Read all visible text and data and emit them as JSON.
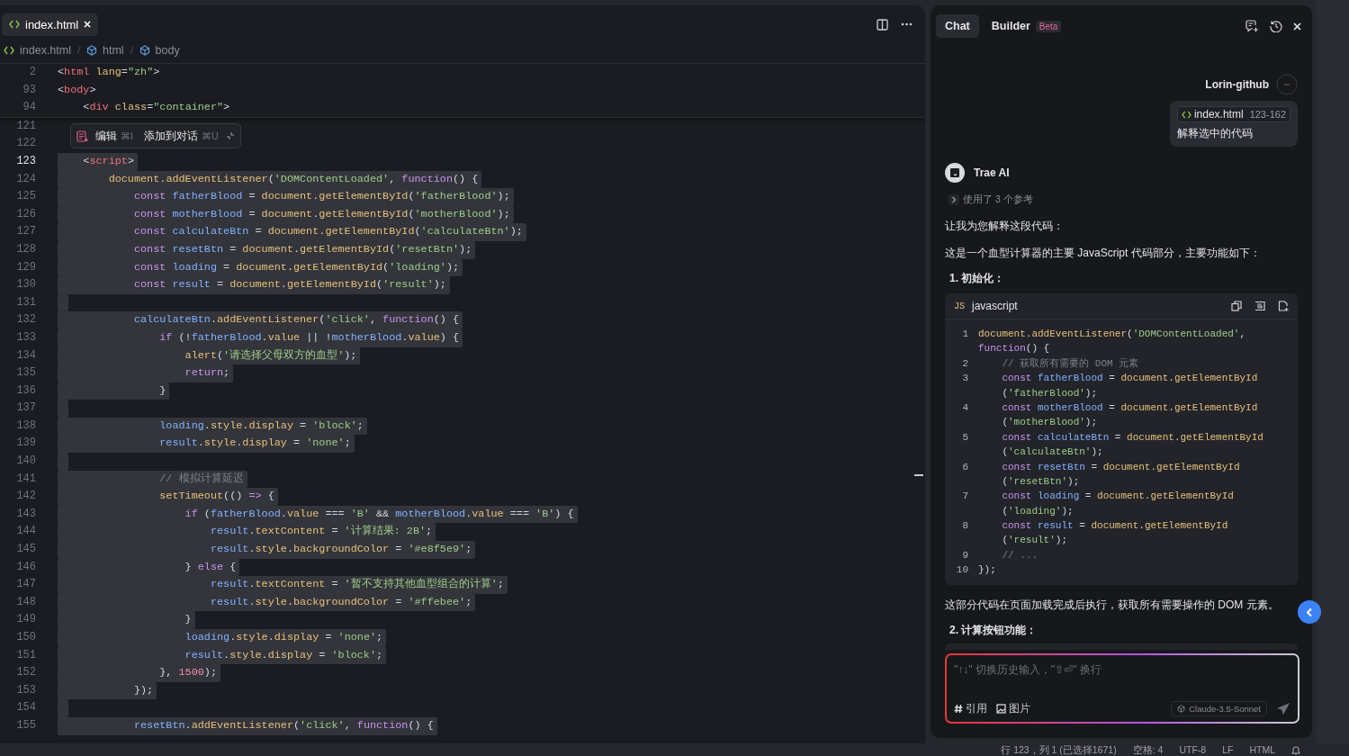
{
  "editor": {
    "tabs": [
      {
        "label": "index.html",
        "selected": true
      }
    ],
    "breadcrumb": [
      "index.html",
      "html",
      "body"
    ],
    "sticky_lines": [
      {
        "number": "2",
        "tokens": [
          {
            "kind": "p",
            "text": "<"
          },
          {
            "kind": "tag",
            "text": "html"
          },
          {
            "kind": "attr",
            "text": " lang"
          },
          {
            "kind": "p",
            "text": "="
          },
          {
            "kind": "str",
            "text": "\"zh\""
          },
          {
            "kind": "p",
            "text": ">"
          }
        ]
      },
      {
        "number": "93",
        "tokens": [
          {
            "kind": "p",
            "text": "<"
          },
          {
            "kind": "tag",
            "text": "body"
          },
          {
            "kind": "p",
            "text": ">"
          }
        ]
      },
      {
        "number": "94",
        "tokens": [
          {
            "kind": "p",
            "text": "    <"
          },
          {
            "kind": "tag",
            "text": "div"
          },
          {
            "kind": "attr",
            "text": " class"
          },
          {
            "kind": "p",
            "text": "="
          },
          {
            "kind": "str",
            "text": "\"container\""
          },
          {
            "kind": "p",
            "text": ">"
          }
        ]
      }
    ],
    "popup": {
      "items": [
        {
          "label": "编辑",
          "shortcut": "⌘I"
        },
        {
          "label": "添加到对话",
          "shortcut": "⌘U"
        }
      ]
    },
    "lines": [
      {
        "number": "121",
        "selected": false,
        "current": false
      },
      {
        "number": "122",
        "selected": false,
        "current": false
      },
      {
        "number": "123",
        "selected": true,
        "current": true,
        "tokens": [
          {
            "kind": "p",
            "text": "    <"
          },
          {
            "kind": "tag",
            "text": "script"
          },
          {
            "kind": "p",
            "text": ">"
          }
        ]
      },
      {
        "number": "124",
        "selected": true,
        "current": false,
        "tokens": [
          {
            "kind": "fn",
            "text": "        document"
          },
          {
            "kind": "p",
            "text": "."
          },
          {
            "kind": "fn",
            "text": "addEventListener"
          },
          {
            "kind": "p",
            "text": "("
          },
          {
            "kind": "str",
            "text": "'DOMContentLoaded'"
          },
          {
            "kind": "p",
            "text": ", "
          },
          {
            "kind": "kw",
            "text": "function"
          },
          {
            "kind": "p",
            "text": "() {"
          }
        ]
      },
      {
        "number": "125",
        "selected": true,
        "current": false,
        "tokens": [
          {
            "kind": "kw",
            "text": "            const"
          },
          {
            "kind": "var",
            "text": " fatherBlood"
          },
          {
            "kind": "p",
            "text": " = "
          },
          {
            "kind": "fn",
            "text": "document"
          },
          {
            "kind": "p",
            "text": "."
          },
          {
            "kind": "fn",
            "text": "getElementById"
          },
          {
            "kind": "p",
            "text": "("
          },
          {
            "kind": "str",
            "text": "'fatherBlood'"
          },
          {
            "kind": "p",
            "text": ");"
          }
        ]
      },
      {
        "number": "126",
        "selected": true,
        "current": false,
        "tokens": [
          {
            "kind": "kw",
            "text": "            const"
          },
          {
            "kind": "var",
            "text": " motherBlood"
          },
          {
            "kind": "p",
            "text": " = "
          },
          {
            "kind": "fn",
            "text": "document"
          },
          {
            "kind": "p",
            "text": "."
          },
          {
            "kind": "fn",
            "text": "getElementById"
          },
          {
            "kind": "p",
            "text": "("
          },
          {
            "kind": "str",
            "text": "'motherBlood'"
          },
          {
            "kind": "p",
            "text": ");"
          }
        ]
      },
      {
        "number": "127",
        "selected": true,
        "current": false,
        "tokens": [
          {
            "kind": "kw",
            "text": "            const"
          },
          {
            "kind": "var",
            "text": " calculateBtn"
          },
          {
            "kind": "p",
            "text": " = "
          },
          {
            "kind": "fn",
            "text": "document"
          },
          {
            "kind": "p",
            "text": "."
          },
          {
            "kind": "fn",
            "text": "getElementById"
          },
          {
            "kind": "p",
            "text": "("
          },
          {
            "kind": "str",
            "text": "'calculateBtn'"
          },
          {
            "kind": "p",
            "text": ");"
          }
        ]
      },
      {
        "number": "128",
        "selected": true,
        "current": false,
        "tokens": [
          {
            "kind": "kw",
            "text": "            const"
          },
          {
            "kind": "var",
            "text": " resetBtn"
          },
          {
            "kind": "p",
            "text": " = "
          },
          {
            "kind": "fn",
            "text": "document"
          },
          {
            "kind": "p",
            "text": "."
          },
          {
            "kind": "fn",
            "text": "getElementById"
          },
          {
            "kind": "p",
            "text": "("
          },
          {
            "kind": "str",
            "text": "'resetBtn'"
          },
          {
            "kind": "p",
            "text": ");"
          }
        ]
      },
      {
        "number": "129",
        "selected": true,
        "current": false,
        "tokens": [
          {
            "kind": "kw",
            "text": "            const"
          },
          {
            "kind": "var",
            "text": " loading"
          },
          {
            "kind": "p",
            "text": " = "
          },
          {
            "kind": "fn",
            "text": "document"
          },
          {
            "kind": "p",
            "text": "."
          },
          {
            "kind": "fn",
            "text": "getElementById"
          },
          {
            "kind": "p",
            "text": "("
          },
          {
            "kind": "str",
            "text": "'loading'"
          },
          {
            "kind": "p",
            "text": ");"
          }
        ]
      },
      {
        "number": "130",
        "selected": true,
        "current": false,
        "tokens": [
          {
            "kind": "kw",
            "text": "            const"
          },
          {
            "kind": "var",
            "text": " result"
          },
          {
            "kind": "p",
            "text": " = "
          },
          {
            "kind": "fn",
            "text": "document"
          },
          {
            "kind": "p",
            "text": "."
          },
          {
            "kind": "fn",
            "text": "getElementById"
          },
          {
            "kind": "p",
            "text": "("
          },
          {
            "kind": "str",
            "text": "'result'"
          },
          {
            "kind": "p",
            "text": ");"
          }
        ]
      },
      {
        "number": "131",
        "selected": true,
        "current": false
      },
      {
        "number": "132",
        "selected": true,
        "current": false,
        "tokens": [
          {
            "kind": "var",
            "text": "            calculateBtn"
          },
          {
            "kind": "p",
            "text": "."
          },
          {
            "kind": "fn",
            "text": "addEventListener"
          },
          {
            "kind": "p",
            "text": "("
          },
          {
            "kind": "str",
            "text": "'click'"
          },
          {
            "kind": "p",
            "text": ", "
          },
          {
            "kind": "kw",
            "text": "function"
          },
          {
            "kind": "p",
            "text": "() {"
          }
        ]
      },
      {
        "number": "133",
        "selected": true,
        "current": false,
        "tokens": [
          {
            "kind": "kw",
            "text": "                if"
          },
          {
            "kind": "p",
            "text": " (!"
          },
          {
            "kind": "var",
            "text": "fatherBlood"
          },
          {
            "kind": "p",
            "text": "."
          },
          {
            "kind": "fn",
            "text": "value"
          },
          {
            "kind": "p",
            "text": " || !"
          },
          {
            "kind": "var",
            "text": "motherBlood"
          },
          {
            "kind": "p",
            "text": "."
          },
          {
            "kind": "fn",
            "text": "value"
          },
          {
            "kind": "p",
            "text": ") {"
          }
        ]
      },
      {
        "number": "134",
        "selected": true,
        "current": false,
        "tokens": [
          {
            "kind": "fn",
            "text": "                    alert"
          },
          {
            "kind": "p",
            "text": "("
          },
          {
            "kind": "str",
            "text": "'请选择父母双方的血型'"
          },
          {
            "kind": "p",
            "text": ");"
          }
        ]
      },
      {
        "number": "135",
        "selected": true,
        "current": false,
        "tokens": [
          {
            "kind": "kw",
            "text": "                    return"
          },
          {
            "kind": "p",
            "text": ";"
          }
        ]
      },
      {
        "number": "136",
        "selected": true,
        "current": false,
        "tokens": [
          {
            "kind": "p",
            "text": "                }"
          }
        ]
      },
      {
        "number": "137",
        "selected": true,
        "current": false
      },
      {
        "number": "138",
        "selected": true,
        "current": false,
        "tokens": [
          {
            "kind": "var",
            "text": "                loading"
          },
          {
            "kind": "p",
            "text": "."
          },
          {
            "kind": "fn",
            "text": "style"
          },
          {
            "kind": "p",
            "text": "."
          },
          {
            "kind": "fn",
            "text": "display"
          },
          {
            "kind": "p",
            "text": " = "
          },
          {
            "kind": "str",
            "text": "'block'"
          },
          {
            "kind": "p",
            "text": ";"
          }
        ]
      },
      {
        "number": "139",
        "selected": true,
        "current": false,
        "tokens": [
          {
            "kind": "var",
            "text": "                result"
          },
          {
            "kind": "p",
            "text": "."
          },
          {
            "kind": "fn",
            "text": "style"
          },
          {
            "kind": "p",
            "text": "."
          },
          {
            "kind": "fn",
            "text": "display"
          },
          {
            "kind": "p",
            "text": " = "
          },
          {
            "kind": "str",
            "text": "'none'"
          },
          {
            "kind": "p",
            "text": ";"
          }
        ]
      },
      {
        "number": "140",
        "selected": true,
        "current": false
      },
      {
        "number": "141",
        "selected": true,
        "current": false,
        "tokens": [
          {
            "kind": "cm",
            "text": "                // 模拟计算延迟"
          }
        ]
      },
      {
        "number": "142",
        "selected": true,
        "current": false,
        "tokens": [
          {
            "kind": "fn",
            "text": "                setTimeout"
          },
          {
            "kind": "p",
            "text": "(() "
          },
          {
            "kind": "kw",
            "text": "=>"
          },
          {
            "kind": "p",
            "text": " {"
          }
        ]
      },
      {
        "number": "143",
        "selected": true,
        "current": false,
        "tokens": [
          {
            "kind": "kw",
            "text": "                    if"
          },
          {
            "kind": "p",
            "text": " ("
          },
          {
            "kind": "var",
            "text": "fatherBlood"
          },
          {
            "kind": "p",
            "text": "."
          },
          {
            "kind": "fn",
            "text": "value"
          },
          {
            "kind": "p",
            "text": " === "
          },
          {
            "kind": "str",
            "text": "'B'"
          },
          {
            "kind": "p",
            "text": " && "
          },
          {
            "kind": "var",
            "text": "motherBlood"
          },
          {
            "kind": "p",
            "text": "."
          },
          {
            "kind": "fn",
            "text": "value"
          },
          {
            "kind": "p",
            "text": " === "
          },
          {
            "kind": "str",
            "text": "'B'"
          },
          {
            "kind": "p",
            "text": ") {"
          }
        ]
      },
      {
        "number": "144",
        "selected": true,
        "current": false,
        "tokens": [
          {
            "kind": "var",
            "text": "                        result"
          },
          {
            "kind": "p",
            "text": "."
          },
          {
            "kind": "fn",
            "text": "textContent"
          },
          {
            "kind": "p",
            "text": " = "
          },
          {
            "kind": "str",
            "text": "'计算结果: 2B'"
          },
          {
            "kind": "p",
            "text": ";"
          }
        ]
      },
      {
        "number": "145",
        "selected": true,
        "current": false,
        "tokens": [
          {
            "kind": "var",
            "text": "                        result"
          },
          {
            "kind": "p",
            "text": "."
          },
          {
            "kind": "fn",
            "text": "style"
          },
          {
            "kind": "p",
            "text": "."
          },
          {
            "kind": "fn",
            "text": "backgroundColor"
          },
          {
            "kind": "p",
            "text": " = "
          },
          {
            "kind": "str",
            "text": "'#e8f5e9'"
          },
          {
            "kind": "p",
            "text": ";"
          }
        ]
      },
      {
        "number": "146",
        "selected": true,
        "current": false,
        "tokens": [
          {
            "kind": "p",
            "text": "                    } "
          },
          {
            "kind": "kw",
            "text": "else"
          },
          {
            "kind": "p",
            "text": " {"
          }
        ]
      },
      {
        "number": "147",
        "selected": true,
        "current": false,
        "tokens": [
          {
            "kind": "var",
            "text": "                        result"
          },
          {
            "kind": "p",
            "text": "."
          },
          {
            "kind": "fn",
            "text": "textContent"
          },
          {
            "kind": "p",
            "text": " = "
          },
          {
            "kind": "str",
            "text": "'暂不支持其他血型组合的计算'"
          },
          {
            "kind": "p",
            "text": ";"
          }
        ]
      },
      {
        "number": "148",
        "selected": true,
        "current": false,
        "tokens": [
          {
            "kind": "var",
            "text": "                        result"
          },
          {
            "kind": "p",
            "text": "."
          },
          {
            "kind": "fn",
            "text": "style"
          },
          {
            "kind": "p",
            "text": "."
          },
          {
            "kind": "fn",
            "text": "backgroundColor"
          },
          {
            "kind": "p",
            "text": " = "
          },
          {
            "kind": "str",
            "text": "'#ffebee'"
          },
          {
            "kind": "p",
            "text": ";"
          }
        ]
      },
      {
        "number": "149",
        "selected": true,
        "current": false,
        "tokens": [
          {
            "kind": "p",
            "text": "                    }"
          }
        ]
      },
      {
        "number": "150",
        "selected": true,
        "current": false,
        "tokens": [
          {
            "kind": "var",
            "text": "                    loading"
          },
          {
            "kind": "p",
            "text": "."
          },
          {
            "kind": "fn",
            "text": "style"
          },
          {
            "kind": "p",
            "text": "."
          },
          {
            "kind": "fn",
            "text": "display"
          },
          {
            "kind": "p",
            "text": " = "
          },
          {
            "kind": "str",
            "text": "'none'"
          },
          {
            "kind": "p",
            "text": ";"
          }
        ]
      },
      {
        "number": "151",
        "selected": true,
        "current": false,
        "tokens": [
          {
            "kind": "var",
            "text": "                    result"
          },
          {
            "kind": "p",
            "text": "."
          },
          {
            "kind": "fn",
            "text": "style"
          },
          {
            "kind": "p",
            "text": "."
          },
          {
            "kind": "fn",
            "text": "display"
          },
          {
            "kind": "p",
            "text": " = "
          },
          {
            "kind": "str",
            "text": "'block'"
          },
          {
            "kind": "p",
            "text": ";"
          }
        ]
      },
      {
        "number": "152",
        "selected": true,
        "current": false,
        "tokens": [
          {
            "kind": "p",
            "text": "                }, "
          },
          {
            "kind": "num",
            "text": "1500"
          },
          {
            "kind": "p",
            "text": ");"
          }
        ]
      },
      {
        "number": "153",
        "selected": true,
        "current": false,
        "tokens": [
          {
            "kind": "p",
            "text": "            });"
          }
        ]
      },
      {
        "number": "154",
        "selected": true,
        "current": false
      },
      {
        "number": "155",
        "selected": true,
        "current": false,
        "tokens": [
          {
            "kind": "var",
            "text": "            resetBtn"
          },
          {
            "kind": "p",
            "text": "."
          },
          {
            "kind": "fn",
            "text": "addEventListener"
          },
          {
            "kind": "p",
            "text": "("
          },
          {
            "kind": "str",
            "text": "'click'"
          },
          {
            "kind": "p",
            "text": ", "
          },
          {
            "kind": "kw",
            "text": "function"
          },
          {
            "kind": "p",
            "text": "() {"
          }
        ]
      }
    ]
  },
  "chat": {
    "tabs": [
      {
        "label": "Chat",
        "selected": true
      },
      {
        "label": "Builder",
        "selected": false,
        "badge": "Beta"
      }
    ],
    "user": {
      "name": "Lorin-github",
      "file": "index.html",
      "range": "123-162",
      "message": "解释选中的代码"
    },
    "assistant": {
      "name": "Trae AI",
      "references": {
        "label": "使用了 3 个参考",
        "expanded": false
      },
      "blocks": [
        {
          "kind": "text",
          "text": "让我为您解释这段代码："
        },
        {
          "kind": "text",
          "text": "这是一个血型计算器的主要 JavaScript 代码部分，主要功能如下："
        },
        {
          "kind": "heading",
          "text": "1. 初始化："
        },
        {
          "kind": "code",
          "badge": "JS",
          "language": "javascript",
          "lines": [
            {
              "number": "1",
              "rows": [
                {
                  "tokens": [
                    {
                      "kind": "fn",
                      "text": "document"
                    },
                    {
                      "kind": "p",
                      "text": "."
                    },
                    {
                      "kind": "fn",
                      "text": "addEventListener"
                    },
                    {
                      "kind": "p",
                      "text": "("
                    },
                    {
                      "kind": "str",
                      "text": "'DOMContentLoaded'"
                    },
                    {
                      "kind": "p",
                      "text": ","
                    }
                  ]
                },
                {
                  "tokens": [
                    {
                      "kind": "kw",
                      "text": "function"
                    },
                    {
                      "kind": "p",
                      "text": "() {"
                    }
                  ]
                }
              ]
            },
            {
              "number": "2",
              "rows": [
                {
                  "tokens": [
                    {
                      "kind": "cm",
                      "text": "    // 获取所有需要的 DOM 元素"
                    }
                  ]
                }
              ]
            },
            {
              "number": "3",
              "rows": [
                {
                  "tokens": [
                    {
                      "kind": "kw",
                      "text": "    const"
                    },
                    {
                      "kind": "var",
                      "text": " fatherBlood"
                    },
                    {
                      "kind": "p",
                      "text": " = "
                    },
                    {
                      "kind": "fn",
                      "text": "document"
                    },
                    {
                      "kind": "p",
                      "text": "."
                    },
                    {
                      "kind": "fn",
                      "text": "getElementById"
                    }
                  ]
                },
                {
                  "tokens": [
                    {
                      "kind": "p",
                      "text": "    ("
                    },
                    {
                      "kind": "str",
                      "text": "'fatherBlood'"
                    },
                    {
                      "kind": "p",
                      "text": ");"
                    }
                  ]
                }
              ]
            },
            {
              "number": "4",
              "rows": [
                {
                  "tokens": [
                    {
                      "kind": "kw",
                      "text": "    const"
                    },
                    {
                      "kind": "var",
                      "text": " motherBlood"
                    },
                    {
                      "kind": "p",
                      "text": " = "
                    },
                    {
                      "kind": "fn",
                      "text": "document"
                    },
                    {
                      "kind": "p",
                      "text": "."
                    },
                    {
                      "kind": "fn",
                      "text": "getElementById"
                    }
                  ]
                },
                {
                  "tokens": [
                    {
                      "kind": "p",
                      "text": "    ("
                    },
                    {
                      "kind": "str",
                      "text": "'motherBlood'"
                    },
                    {
                      "kind": "p",
                      "text": ");"
                    }
                  ]
                }
              ]
            },
            {
              "number": "5",
              "rows": [
                {
                  "tokens": [
                    {
                      "kind": "kw",
                      "text": "    const"
                    },
                    {
                      "kind": "var",
                      "text": " calculateBtn"
                    },
                    {
                      "kind": "p",
                      "text": " = "
                    },
                    {
                      "kind": "fn",
                      "text": "document"
                    },
                    {
                      "kind": "p",
                      "text": "."
                    },
                    {
                      "kind": "fn",
                      "text": "getElementById"
                    }
                  ]
                },
                {
                  "tokens": [
                    {
                      "kind": "p",
                      "text": "    ("
                    },
                    {
                      "kind": "str",
                      "text": "'calculateBtn'"
                    },
                    {
                      "kind": "p",
                      "text": ");"
                    }
                  ]
                }
              ]
            },
            {
              "number": "6",
              "rows": [
                {
                  "tokens": [
                    {
                      "kind": "kw",
                      "text": "    const"
                    },
                    {
                      "kind": "var",
                      "text": " resetBtn"
                    },
                    {
                      "kind": "p",
                      "text": " = "
                    },
                    {
                      "kind": "fn",
                      "text": "document"
                    },
                    {
                      "kind": "p",
                      "text": "."
                    },
                    {
                      "kind": "fn",
                      "text": "getElementById"
                    }
                  ]
                },
                {
                  "tokens": [
                    {
                      "kind": "p",
                      "text": "    ("
                    },
                    {
                      "kind": "str",
                      "text": "'resetBtn'"
                    },
                    {
                      "kind": "p",
                      "text": ");"
                    }
                  ]
                }
              ]
            },
            {
              "number": "7",
              "rows": [
                {
                  "tokens": [
                    {
                      "kind": "kw",
                      "text": "    const"
                    },
                    {
                      "kind": "var",
                      "text": " loading"
                    },
                    {
                      "kind": "p",
                      "text": " = "
                    },
                    {
                      "kind": "fn",
                      "text": "document"
                    },
                    {
                      "kind": "p",
                      "text": "."
                    },
                    {
                      "kind": "fn",
                      "text": "getElementById"
                    }
                  ]
                },
                {
                  "tokens": [
                    {
                      "kind": "p",
                      "text": "    ("
                    },
                    {
                      "kind": "str",
                      "text": "'loading'"
                    },
                    {
                      "kind": "p",
                      "text": ");"
                    }
                  ]
                }
              ]
            },
            {
              "number": "8",
              "rows": [
                {
                  "tokens": [
                    {
                      "kind": "kw",
                      "text": "    const"
                    },
                    {
                      "kind": "var",
                      "text": " result"
                    },
                    {
                      "kind": "p",
                      "text": " = "
                    },
                    {
                      "kind": "fn",
                      "text": "document"
                    },
                    {
                      "kind": "p",
                      "text": "."
                    },
                    {
                      "kind": "fn",
                      "text": "getElementById"
                    }
                  ]
                },
                {
                  "tokens": [
                    {
                      "kind": "p",
                      "text": "    ("
                    },
                    {
                      "kind": "str",
                      "text": "'result'"
                    },
                    {
                      "kind": "p",
                      "text": ");"
                    }
                  ]
                }
              ]
            },
            {
              "number": "9",
              "rows": [
                {
                  "tokens": [
                    {
                      "kind": "cm",
                      "text": "    // ..."
                    }
                  ]
                }
              ]
            },
            {
              "number": "10",
              "rows": [
                {
                  "tokens": [
                    {
                      "kind": "p",
                      "text": "});"
                    }
                  ]
                }
              ]
            }
          ]
        },
        {
          "kind": "text",
          "text": "这部分代码在页面加载完成后执行，获取所有需要操作的 DOM 元素。"
        },
        {
          "kind": "heading",
          "text": "2. 计算按钮功能："
        },
        {
          "kind": "code_cut"
        }
      ]
    },
    "input": {
      "placeholder": "\"↑↓\" 切换历史输入，\"⇧⏎\" 换行",
      "reference": "引用",
      "image": "图片",
      "model": "Claude-3.5-Sonnet"
    }
  },
  "status_bar": [
    "行 123，列 1 (已选择1671)",
    "空格: 4",
    "UTF-8",
    "LF",
    "HTML"
  ]
}
